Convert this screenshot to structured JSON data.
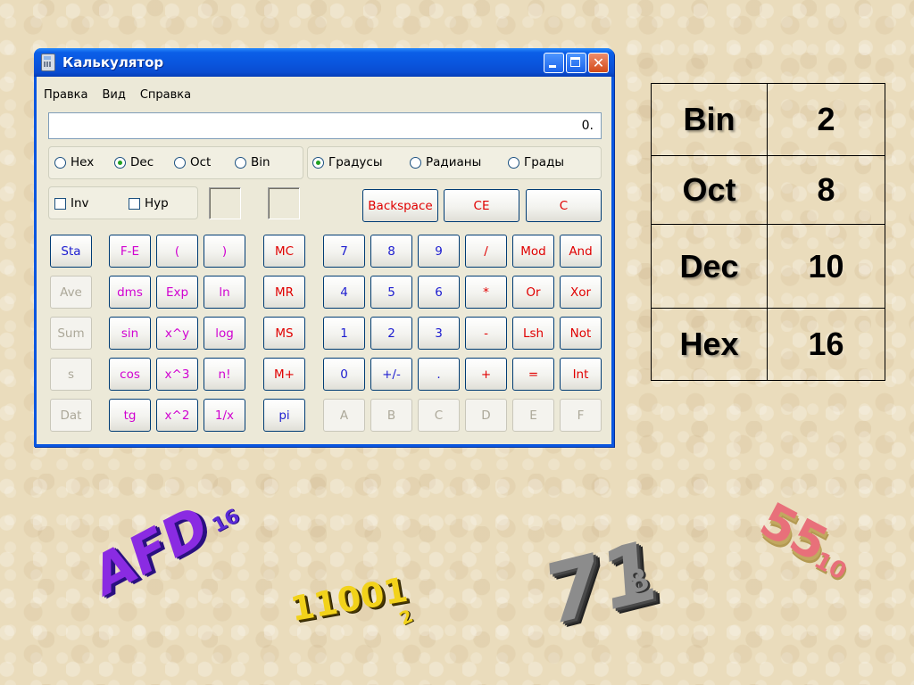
{
  "window": {
    "title": "Калькулятор",
    "menu": [
      "Правка",
      "Вид",
      "Справка"
    ]
  },
  "display": {
    "value": "0."
  },
  "radix": [
    {
      "label": "Hex",
      "checked": false
    },
    {
      "label": "Dec",
      "checked": true
    },
    {
      "label": "Oct",
      "checked": false
    },
    {
      "label": "Bin",
      "checked": false
    }
  ],
  "angle": [
    {
      "label": "Градусы",
      "checked": true
    },
    {
      "label": "Радианы",
      "checked": false
    },
    {
      "label": "Грады",
      "checked": false
    }
  ],
  "checkboxes": [
    {
      "label": "Inv"
    },
    {
      "label": "Hyp"
    }
  ],
  "edit_buttons": [
    "Backspace",
    "CE",
    "C"
  ],
  "stat_buttons": [
    "Sta",
    "Ave",
    "Sum",
    "s",
    "Dat"
  ],
  "func_col1": [
    "F-E",
    "dms",
    "sin",
    "cos",
    "tg"
  ],
  "func_col2": [
    "(",
    "Exp",
    "x^y",
    "x^3",
    "x^2"
  ],
  "func_col3": [
    ")",
    "ln",
    "log",
    "n!",
    "1/x"
  ],
  "mem_buttons": [
    "MC",
    "MR",
    "MS",
    "M+",
    "pi"
  ],
  "digit_rows": [
    [
      "7",
      "8",
      "9",
      "/",
      "Mod",
      "And"
    ],
    [
      "4",
      "5",
      "6",
      "*",
      "Or",
      "Xor"
    ],
    [
      "1",
      "2",
      "3",
      "-",
      "Lsh",
      "Not"
    ],
    [
      "0",
      "+/-",
      ".",
      "+",
      "=",
      "Int"
    ],
    [
      "A",
      "B",
      "C",
      "D",
      "E",
      "F"
    ]
  ],
  "radix_table": [
    {
      "name": "Bin",
      "base": "2"
    },
    {
      "name": "Oct",
      "base": "8"
    },
    {
      "name": "Dec",
      "base": "10"
    },
    {
      "name": "Hex",
      "base": "16"
    }
  ],
  "wordart": {
    "afd": "AFD",
    "afd_sub": "16",
    "bin": "11001",
    "bin_sub": "2",
    "oct": "71",
    "oct_sub": "8",
    "dec": "55",
    "dec_sub": "10"
  }
}
